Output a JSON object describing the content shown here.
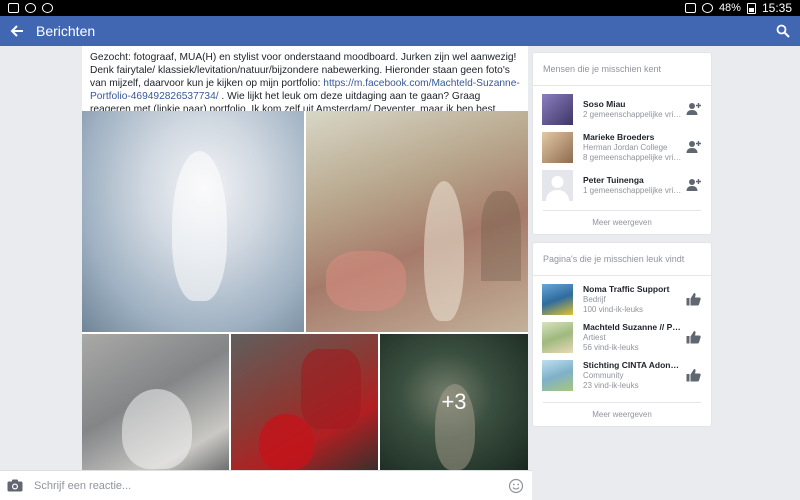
{
  "status_bar": {
    "battery": "48%",
    "time": "15:35"
  },
  "app_bar": {
    "title": "Berichten"
  },
  "post": {
    "text_before_link": "Gezocht: fotograaf, MUA(H) en stylist voor onderstaand moodboard. Jurken zijn wel aanwezig! Denk fairytale/ klassiek/levitation/natuur/bijzondere nabewerking. Hieronder staan geen foto's van mijzelf, daarvoor kun je kijken op mijn portfolio: ",
    "link": "https://m.facebook.com/Machteld-Suzanne-Portfolio-469492826537734/",
    "text_after_link": " . Wie lijkt het leuk om deze uitdaging aan te gaan? Graag reageren met (linkje naar) portfolio. Ik kom zelf uit Amsterdam/ Deventer, maar ik ben best bereid te reizen voor een leuk concept!",
    "more_photos": "+3"
  },
  "comment_bar": {
    "placeholder": "Schrijf een reactie..."
  },
  "people_card": {
    "title": "Mensen die je misschien kent",
    "items": [
      {
        "name": "Soso Miau",
        "sub": "2 gemeenschappelijke vrie...",
        "color": "#6a5f9e"
      },
      {
        "name": "Marieke Broeders",
        "sub": "Herman Jordan College",
        "sub2": "8 gemeenschappelijke vrie...",
        "color": "#c7a27a"
      },
      {
        "name": "Peter Tuinenga",
        "sub": "1 gemeenschappelijke vrie...",
        "color": "#dcdcdc"
      }
    ],
    "more": "Meer weergeven"
  },
  "pages_card": {
    "title": "Pagina's die je misschien leuk vindt",
    "items": [
      {
        "name": "Noma Traffic Support",
        "sub": "Bedrijf",
        "sub2": "100 vind-ik-leuks",
        "color": "#2f6c9e"
      },
      {
        "name": "Machteld Suzanne // Port...",
        "sub": "Artiest",
        "sub2": "56 vind-ik-leuks",
        "color": "#9fb97e"
      },
      {
        "name": "Stichting CINTA Adonara,...",
        "sub": "Community",
        "sub2": "23 vind-ik-leuks",
        "color": "#7fb0c9"
      }
    ],
    "more": "Meer weergeven"
  }
}
